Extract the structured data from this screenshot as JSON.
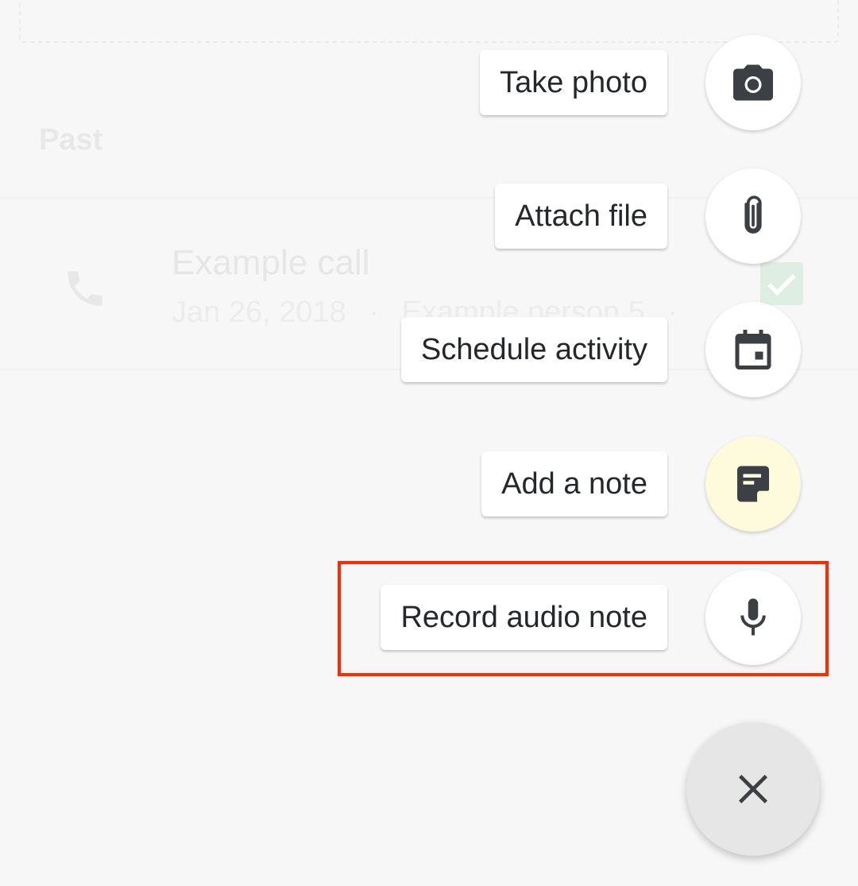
{
  "background": {
    "section_label": "Past",
    "activity": {
      "title": "Example call",
      "date": "Jan 26, 2018",
      "separator": "·",
      "person": "Example person 5",
      "trailing_separator": "·",
      "icon": "phone-icon",
      "status": "done",
      "status_color": "#deeee3"
    }
  },
  "speed_dial": {
    "items": [
      {
        "label": "Take photo",
        "icon": "camera-icon",
        "fab_color": "#ffffff"
      },
      {
        "label": "Attach file",
        "icon": "paperclip-icon",
        "fab_color": "#ffffff"
      },
      {
        "label": "Schedule activity",
        "icon": "calendar-icon",
        "fab_color": "#ffffff"
      },
      {
        "label": "Add a note",
        "icon": "note-icon",
        "fab_color": "#fefbdd"
      },
      {
        "label": "Record audio note",
        "icon": "microphone-icon",
        "fab_color": "#ffffff",
        "highlighted": true
      }
    ],
    "close_button": {
      "icon": "close-icon",
      "color": "#e6e6e6"
    },
    "highlight_color": "#ff2a00"
  }
}
